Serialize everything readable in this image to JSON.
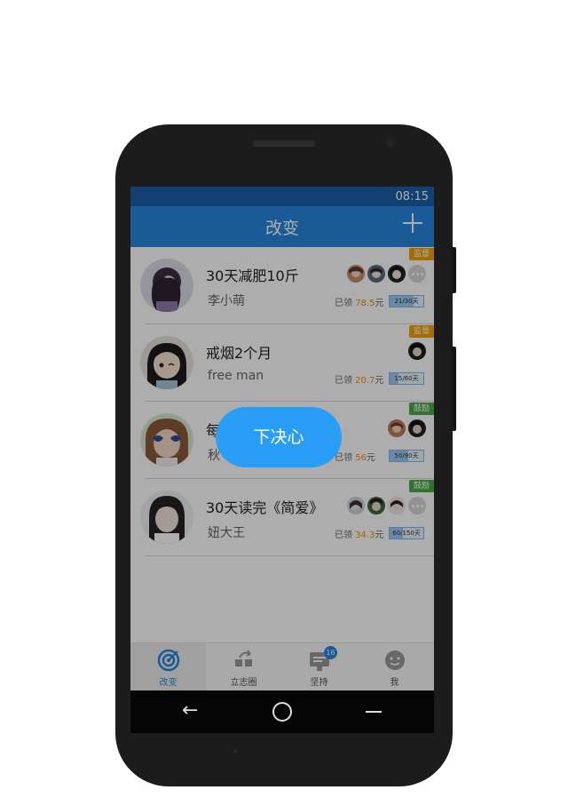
{
  "status": {
    "time": "08:15"
  },
  "header": {
    "title": "改变"
  },
  "goals": [
    {
      "tag": "监督",
      "tag_color": "#f2a100",
      "title": "30天减肥10斤",
      "author": "李小萌",
      "earned_prefix": "已领",
      "earned_amount": "78.5",
      "earned_unit": "元",
      "progress_label": "21/30天",
      "progress": 0.7,
      "supporter_count": 3,
      "has_more": true
    },
    {
      "tag": "监督",
      "tag_color": "#f2a100",
      "title": "戒烟2个月",
      "author": "free man",
      "earned_prefix": "已领",
      "earned_amount": "20.7",
      "earned_unit": "元",
      "progress_label": "15/60天",
      "progress": 0.25,
      "supporter_count": 1,
      "has_more": false
    },
    {
      "tag": "鼓励",
      "tag_color": "#4aa84a",
      "title": "每",
      "author": "秋",
      "earned_prefix": "已领",
      "earned_amount": "56",
      "earned_unit": "元",
      "progress_label": "50/90天",
      "progress": 0.56,
      "supporter_count": 2,
      "has_more": false
    },
    {
      "tag": "鼓励",
      "tag_color": "#4aa84a",
      "title": "30天读完《简爱》",
      "author": "妞大王",
      "earned_prefix": "已领",
      "earned_amount": "34.3",
      "earned_unit": "元",
      "progress_label": "60/150天",
      "progress": 0.4,
      "supporter_count": 3,
      "has_more": true
    }
  ],
  "tabs": [
    {
      "label": "改变",
      "icon": "target-icon",
      "active": true
    },
    {
      "label": "立志圈",
      "icon": "share-icon"
    },
    {
      "label": "坚持",
      "icon": "checkin-icon",
      "badge": "16"
    },
    {
      "label": "我",
      "icon": "face-icon"
    }
  ],
  "popup": {
    "label": "下决心"
  },
  "colors": {
    "accent": "#2787df",
    "status_bar": "#1b5fa8",
    "popup": "#2a9ef6",
    "earned": "#f08c00"
  }
}
